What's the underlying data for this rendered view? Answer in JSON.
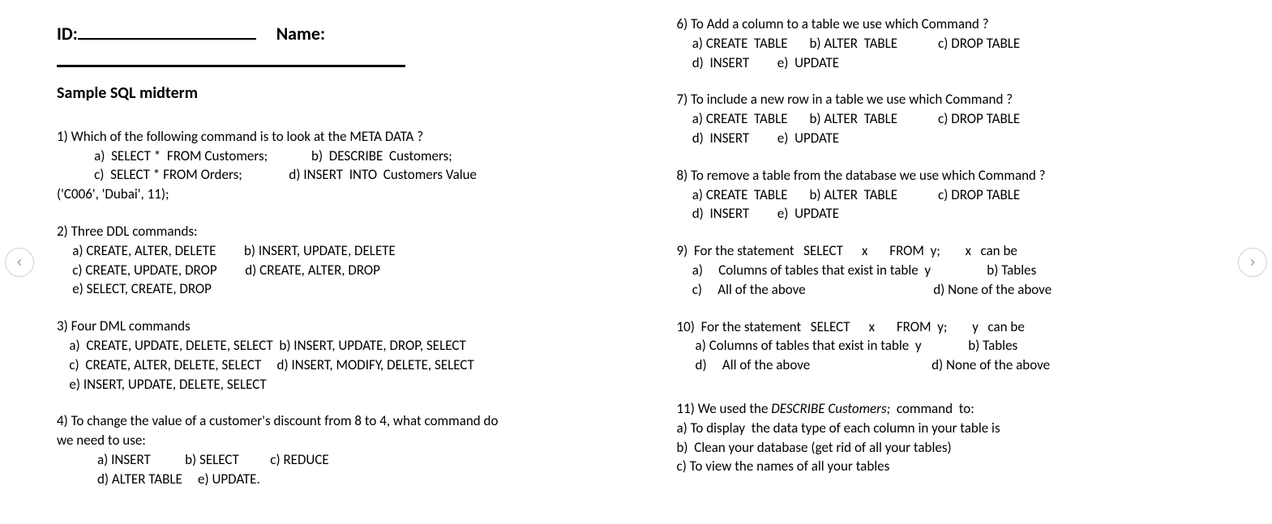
{
  "header": {
    "id_label": "ID:",
    "name_label": "Name:"
  },
  "title": "Sample SQL  midterm",
  "left": {
    "q1": {
      "l1": "1) Which of the following command is to look at the META DATA ?",
      "l2": "            a)  SELECT *  FROM Customers;              b)  DESCRIBE  Customers;",
      "l3": "            c)  SELECT * FROM Orders;               d) INSERT  INTO  Customers Value",
      "l4": "('C006', 'Dubai', 11);"
    },
    "q2": {
      "l1": "2) Three DDL commands:",
      "l2": "     a) CREATE, ALTER, DELETE         b) INSERT, UPDATE, DELETE",
      "l3": "     c) CREATE, UPDATE, DROP         d) CREATE, ALTER, DROP",
      "l4": "     e) SELECT, CREATE, DROP"
    },
    "q3": {
      "l1": "3) Four DML commands",
      "l2": "    a)  CREATE, UPDATE, DELETE, SELECT  b) INSERT, UPDATE, DROP, SELECT",
      "l3": "    c)  CREATE, ALTER, DELETE, SELECT     d) INSERT, MODIFY, DELETE, SELECT",
      "l4": "    e) INSERT, UPDATE, DELETE, SELECT"
    },
    "q4": {
      "l1": "4) To change the value of a customer's discount from 8 to 4, what command do",
      "l2": "we need to use:",
      "l3": "             a) INSERT           b) SELECT          c) REDUCE",
      "l4": "             d) ALTER TABLE     e) UPDATE."
    }
  },
  "right": {
    "q6": {
      "l1": "6) To Add a column to a table we use which Command ?",
      "l2": "     a) CREATE  TABLE       b) ALTER  TABLE             c) DROP TABLE",
      "l3": "     d)  INSERT         e)  UPDATE"
    },
    "q7": {
      "l1": "7) To include a new row in a table we use which Command ?",
      "l2": "     a) CREATE  TABLE       b) ALTER  TABLE             c) DROP TABLE",
      "l3": "     d)  INSERT         e)  UPDATE"
    },
    "q8": {
      "l1": "8) To remove a table from the database we use which Command ?",
      "l2": "     a) CREATE  TABLE       b) ALTER  TABLE             c) DROP TABLE",
      "l3": "     d)  INSERT         e)  UPDATE"
    },
    "q9": {
      "l1": "9)  For the statement   SELECT      x       FROM  y;        x   can be",
      "l2": "     a)     Columns of tables that exist in table  y                  b) Tables",
      "l3": "     c)     All of the above                                         d) None of the above"
    },
    "q10": {
      "l1": "10)  For the statement   SELECT      x       FROM  y;        y   can be",
      "l2": "      a) Columns of tables that exist in table  y               b) Tables",
      "l3": "      d)     All of the above                                       d) None of the above"
    },
    "q11": {
      "l1_pre": "11) We used the ",
      "l1_em": "DESCRIBE Customers;",
      "l1_post": "  command  to:",
      "l2": "a) To display  the data type of each column in your table is",
      "l3": "b)  Clean your database (get rid of all your tables)",
      "l4": "c) To view the names of all your tables"
    }
  }
}
